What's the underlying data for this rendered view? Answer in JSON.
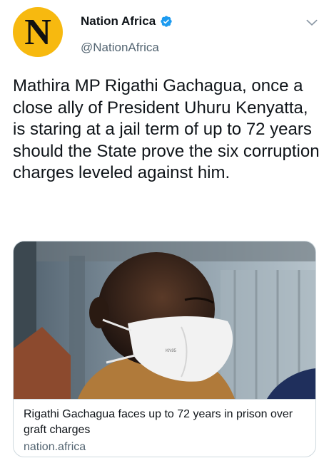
{
  "author": {
    "avatar_letter": "N",
    "display_name": "Nation Africa",
    "handle": "@NationAfrica",
    "verified": true,
    "verified_icon": "verified-badge-icon",
    "avatar_color": "#f7b90f"
  },
  "menu": {
    "icon": "chevron-down-icon"
  },
  "tweet": {
    "text": "Mathira MP Rigathi Gachagua, once a close ally of President Uhuru Kenyatta, is staring at a jail term of up to 72 years should the State prove the six corruption charges leveled against him."
  },
  "card": {
    "title": "Rigathi Gachagua faces up to 72 years in prison over graft charges",
    "domain": "nation.africa",
    "image_label": "KN95"
  },
  "colors": {
    "accent": "#1d9bf0",
    "text": "#0f1419",
    "muted": "#536471",
    "border": "#cfd9de"
  }
}
